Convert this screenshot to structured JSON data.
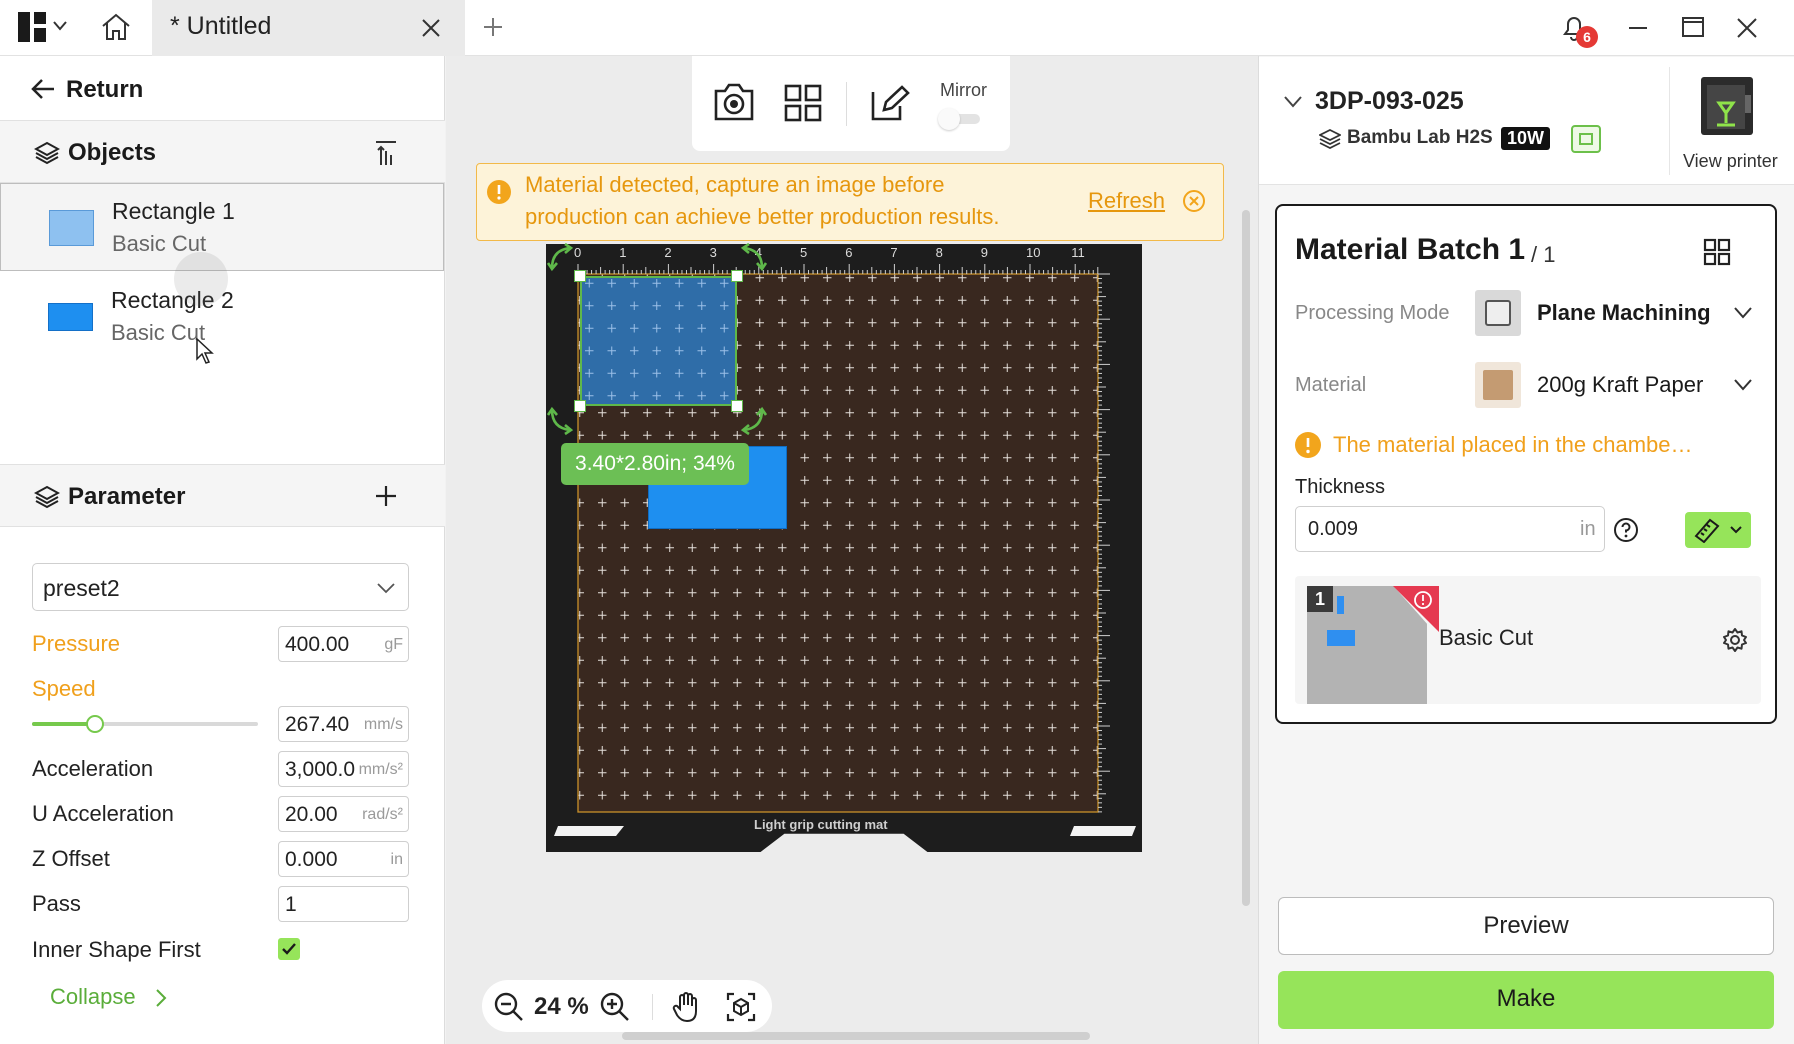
{
  "titlebar": {
    "tab_title": "* Untitled",
    "notification_count": "6"
  },
  "left": {
    "return_label": "Return",
    "objects_header": "Objects",
    "objects": [
      {
        "name": "Rectangle 1",
        "type": "Basic Cut",
        "color": "#8ec1f0"
      },
      {
        "name": "Rectangle 2",
        "type": "Basic Cut",
        "color": "#1e8ff0"
      }
    ],
    "parameter_header": "Parameter",
    "preset": "preset2",
    "params": {
      "pressure": {
        "label": "Pressure",
        "value": "400.00",
        "unit": "gF"
      },
      "speed": {
        "label": "Speed",
        "value": "267.40",
        "unit": "mm/s",
        "slider_fraction": 0.28
      },
      "acceleration": {
        "label": "Acceleration",
        "value": "3,000.0",
        "unit": "mm/s²"
      },
      "u_acceleration": {
        "label": "U Acceleration",
        "value": "20.00",
        "unit": "rad/s²"
      },
      "z_offset": {
        "label": "Z Offset",
        "value": "0.000",
        "unit": "in"
      },
      "pass": {
        "label": "Pass",
        "value": "1"
      },
      "inner_shape_first": {
        "label": "Inner Shape First",
        "checked": true
      }
    },
    "collapse_label": "Collapse"
  },
  "canvas": {
    "toolbar": {
      "mirror_label": "Mirror"
    },
    "alert": {
      "line1": "Material detected, capture an image before",
      "line2": "production can achieve better production results.",
      "refresh": "Refresh"
    },
    "ruler_labels": [
      "0",
      "1",
      "2",
      "3",
      "4",
      "5",
      "6",
      "7",
      "8",
      "9",
      "10",
      "11"
    ],
    "selection_label": "3.40*2.80in; 34%",
    "mat_label": "Light grip cutting mat",
    "zoom": "24 %"
  },
  "right": {
    "device_name": "3DP-093-025",
    "printer_model": "Bambu Lab H2S",
    "laser_power": "10W",
    "view_printer": "View printer",
    "batch_title": "Material Batch 1",
    "batch_total": "/ 1",
    "processing_mode_label": "Processing Mode",
    "processing_mode": "Plane Machining",
    "material_label": "Material",
    "material": "200g Kraft Paper",
    "warning": "The material placed in the chambe…",
    "thickness_label": "Thickness",
    "thickness_value": "0.009",
    "thickness_unit": "in",
    "plate_index": "1",
    "plate_process": "Basic Cut",
    "preview_label": "Preview",
    "make_label": "Make",
    "accent_color": "#96e45a"
  }
}
